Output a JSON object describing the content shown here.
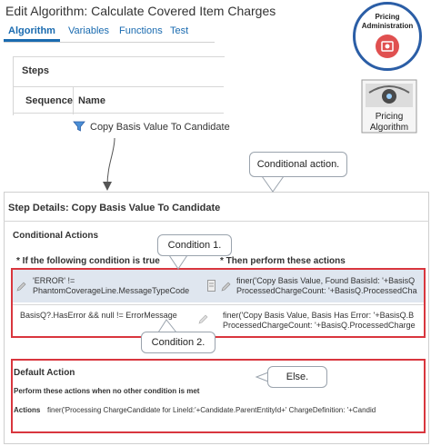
{
  "header": {
    "title": "Edit Algorithm: Calculate Covered Item Charges",
    "tabs": [
      {
        "label": "Algorithm",
        "active": true
      },
      {
        "label": "Variables"
      },
      {
        "label": "Functions"
      },
      {
        "label": "Test"
      }
    ]
  },
  "steps": {
    "title": "Steps",
    "columns": [
      "Sequence",
      "Name"
    ],
    "selected_step": "Copy Basis Value To Candidate"
  },
  "badges": {
    "pricing_admin": "Pricing Administration",
    "pricing_algorithm": "Pricing Algorithm"
  },
  "details": {
    "title": "Step Details: Copy Basis Value To Candidate",
    "conditional_actions": {
      "heading": "Conditional Actions",
      "if_label": "* If the following condition is true",
      "then_label": "* Then perform these actions",
      "rows": [
        {
          "condition_line1": "'ERROR' !=",
          "condition_line2": "PhantomCoverageLine.MessageTypeCode",
          "action_line1": "finer('Copy Basis Value, Found BasisId: '+BasisQ",
          "action_line2": "ProcessedChargeCount: '+BasisQ.ProcessedCha"
        },
        {
          "condition_line1": "BasisQ?.HasError && null != ErrorMessage",
          "action_line1": "finer('Copy Basis Value, Basis Has Error: '+BasisQ.B",
          "action_line2": "ProcessedChargeCount: '+BasisQ.ProcessedCharge"
        }
      ]
    },
    "default_action": {
      "heading": "Default Action",
      "text": "Perform these actions when no other condition is met",
      "actions_label": "Actions",
      "actions_value": "finer('Processing ChargeCandidate for LineId:'+Candidate.ParentEntityId+' ChargeDefinition: '+Candid"
    }
  },
  "callouts": {
    "conditional_action": "Conditional action.",
    "condition1": "Condition 1.",
    "condition2": "Condition 2.",
    "else": "Else."
  },
  "colors": {
    "accent": "#1a6bb0",
    "highlight_box": "#d9363e",
    "selected_row": "#dfe6ef",
    "badge_ring": "#2b5ea6"
  }
}
